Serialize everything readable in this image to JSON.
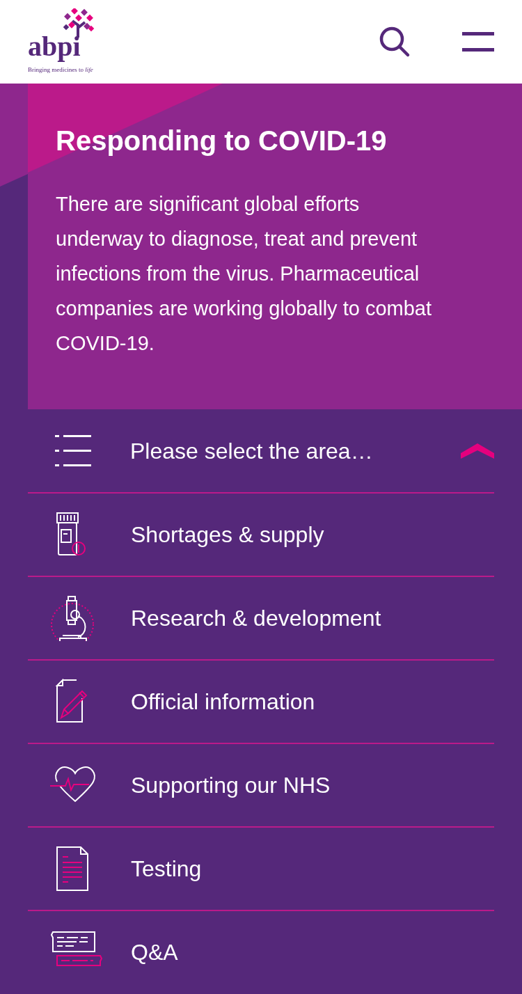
{
  "header": {
    "logo": {
      "wordmark": "abpi",
      "tagline": "Bringing medicines to *life*"
    }
  },
  "hero": {
    "title": "Responding to COVID-19",
    "body": "There are significant global efforts underway to diagnose, treat and prevent infections from the virus. Pharmaceutical companies are working globally to combat COVID-19."
  },
  "area_menu": {
    "label": "Please select the area…",
    "expanded": true,
    "items": [
      {
        "kind": "supply",
        "label": "Shortages & supply"
      },
      {
        "kind": "research",
        "label": "Research & development"
      },
      {
        "kind": "official",
        "label": "Official information"
      },
      {
        "kind": "nhs",
        "label": "Supporting our NHS"
      },
      {
        "kind": "testing",
        "label": "Testing"
      },
      {
        "kind": "qa",
        "label": "Q&A"
      }
    ]
  }
}
